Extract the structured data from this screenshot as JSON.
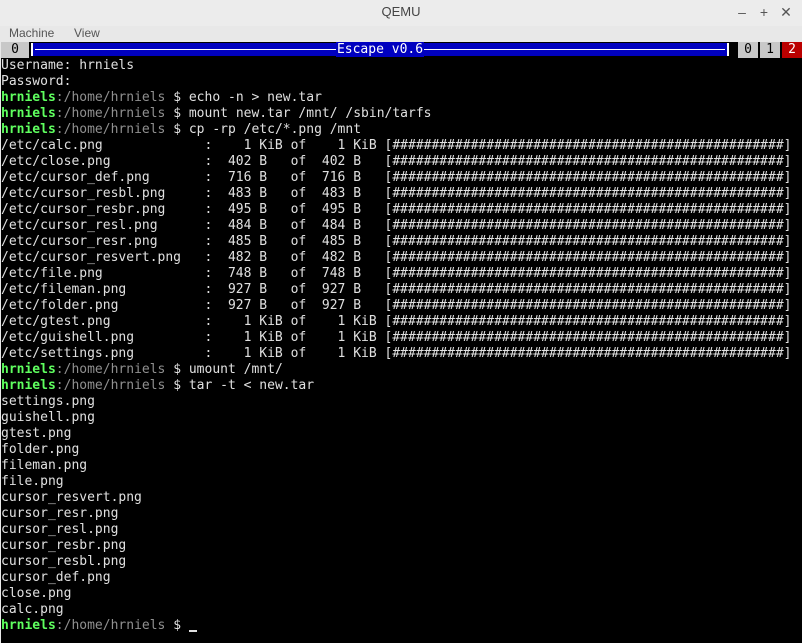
{
  "window": {
    "title": "QEMU",
    "buttons": [
      "–",
      "+",
      "✕"
    ]
  },
  "menubar": {
    "items": [
      "Machine",
      "View"
    ]
  },
  "statusbar": {
    "left_tab": "0",
    "title": "Escape v0.6",
    "tabs": [
      "0",
      "1",
      "2"
    ],
    "active_tab": "2",
    "colors": {
      "title_bg": "#0000c0",
      "active_tab_bg": "#bb0000"
    }
  },
  "terminal": {
    "lines": [
      {
        "type": "text",
        "text": "Username: hrniels"
      },
      {
        "type": "text",
        "text": "Password:"
      },
      {
        "type": "prompt",
        "user": "hrniels",
        "path": ":/home/hrniels",
        "rest": " $ echo -n > new.tar"
      },
      {
        "type": "prompt",
        "user": "hrniels",
        "path": ":/home/hrniels",
        "rest": " $ mount new.tar /mnt/ /sbin/tarfs"
      },
      {
        "type": "prompt",
        "user": "hrniels",
        "path": ":/home/hrniels",
        "rest": " $ cp -rp /etc/*.png /mnt"
      },
      {
        "type": "text",
        "text": "/etc/calc.png             :    1 KiB of    1 KiB [##################################################]"
      },
      {
        "type": "text",
        "text": "/etc/close.png            :  402 B   of  402 B   [##################################################]"
      },
      {
        "type": "text",
        "text": "/etc/cursor_def.png       :  716 B   of  716 B   [##################################################]"
      },
      {
        "type": "text",
        "text": "/etc/cursor_resbl.png     :  483 B   of  483 B   [##################################################]"
      },
      {
        "type": "text",
        "text": "/etc/cursor_resbr.png     :  495 B   of  495 B   [##################################################]"
      },
      {
        "type": "text",
        "text": "/etc/cursor_resl.png      :  484 B   of  484 B   [##################################################]"
      },
      {
        "type": "text",
        "text": "/etc/cursor_resr.png      :  485 B   of  485 B   [##################################################]"
      },
      {
        "type": "text",
        "text": "/etc/cursor_resvert.png   :  482 B   of  482 B   [##################################################]"
      },
      {
        "type": "text",
        "text": "/etc/file.png             :  748 B   of  748 B   [##################################################]"
      },
      {
        "type": "text",
        "text": "/etc/fileman.png          :  927 B   of  927 B   [##################################################]"
      },
      {
        "type": "text",
        "text": "/etc/folder.png           :  927 B   of  927 B   [##################################################]"
      },
      {
        "type": "text",
        "text": "/etc/gtest.png            :    1 KiB of    1 KiB [##################################################]"
      },
      {
        "type": "text",
        "text": "/etc/guishell.png         :    1 KiB of    1 KiB [##################################################]"
      },
      {
        "type": "text",
        "text": "/etc/settings.png         :    1 KiB of    1 KiB [##################################################]"
      },
      {
        "type": "prompt",
        "user": "hrniels",
        "path": ":/home/hrniels",
        "rest": " $ umount /mnt/"
      },
      {
        "type": "prompt",
        "user": "hrniels",
        "path": ":/home/hrniels",
        "rest": " $ tar -t < new.tar"
      },
      {
        "type": "text",
        "text": "settings.png"
      },
      {
        "type": "text",
        "text": "guishell.png"
      },
      {
        "type": "text",
        "text": "gtest.png"
      },
      {
        "type": "text",
        "text": "folder.png"
      },
      {
        "type": "text",
        "text": "fileman.png"
      },
      {
        "type": "text",
        "text": "file.png"
      },
      {
        "type": "text",
        "text": "cursor_resvert.png"
      },
      {
        "type": "text",
        "text": "cursor_resr.png"
      },
      {
        "type": "text",
        "text": "cursor_resl.png"
      },
      {
        "type": "text",
        "text": "cursor_resbr.png"
      },
      {
        "type": "text",
        "text": "cursor_resbl.png"
      },
      {
        "type": "text",
        "text": "cursor_def.png"
      },
      {
        "type": "text",
        "text": "close.png"
      },
      {
        "type": "text",
        "text": "calc.png"
      },
      {
        "type": "prompt",
        "user": "hrniels",
        "path": ":/home/hrniels",
        "rest": " $ ",
        "cursor": true
      }
    ],
    "colors": {
      "user": "#5fff5f",
      "path": "#909090",
      "text": "#e0e0e0",
      "background": "#000000"
    }
  }
}
